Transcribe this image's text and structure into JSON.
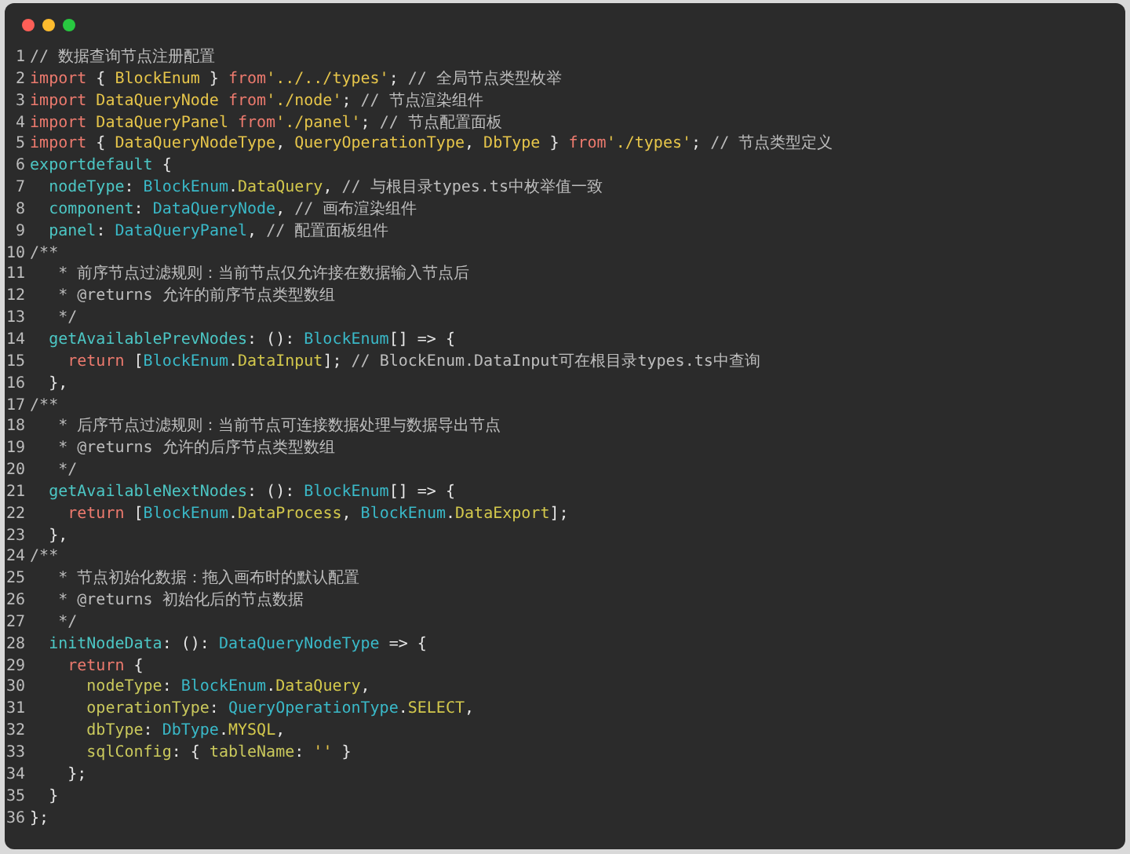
{
  "code_lines": [
    {
      "number": "1",
      "tokens": [
        {
          "text": "// 数据查询节点注册配置",
          "kind": "comment"
        }
      ]
    },
    {
      "number": "2",
      "tokens": [
        {
          "text": "import",
          "kind": "keyword"
        },
        {
          "text": " { ",
          "kind": "plain"
        },
        {
          "text": "BlockEnum",
          "kind": "ident"
        },
        {
          "text": " } ",
          "kind": "plain"
        },
        {
          "text": "from",
          "kind": "keyword"
        },
        {
          "text": "'../../types'",
          "kind": "string"
        },
        {
          "text": "; ",
          "kind": "plain"
        },
        {
          "text": "// 全局节点类型枚举",
          "kind": "comment"
        }
      ]
    },
    {
      "number": "3",
      "tokens": [
        {
          "text": "import",
          "kind": "keyword"
        },
        {
          "text": " DataQueryNode ",
          "kind": "ident"
        },
        {
          "text": "from",
          "kind": "keyword"
        },
        {
          "text": "'./node'",
          "kind": "string"
        },
        {
          "text": "; ",
          "kind": "plain"
        },
        {
          "text": "// 节点渲染组件",
          "kind": "comment"
        }
      ]
    },
    {
      "number": "4",
      "tokens": [
        {
          "text": "import",
          "kind": "keyword"
        },
        {
          "text": " DataQueryPanel ",
          "kind": "ident"
        },
        {
          "text": "from",
          "kind": "keyword"
        },
        {
          "text": "'./panel'",
          "kind": "string"
        },
        {
          "text": "; ",
          "kind": "plain"
        },
        {
          "text": "// 节点配置面板",
          "kind": "comment"
        }
      ]
    },
    {
      "number": "5",
      "tokens": [
        {
          "text": "import",
          "kind": "keyword"
        },
        {
          "text": " { ",
          "kind": "plain"
        },
        {
          "text": "DataQueryNodeType",
          "kind": "ident"
        },
        {
          "text": ", ",
          "kind": "plain"
        },
        {
          "text": "QueryOperationType",
          "kind": "ident"
        },
        {
          "text": ", ",
          "kind": "plain"
        },
        {
          "text": "DbType",
          "kind": "ident"
        },
        {
          "text": " } ",
          "kind": "plain"
        },
        {
          "text": "from",
          "kind": "keyword"
        },
        {
          "text": "'./types'",
          "kind": "string"
        },
        {
          "text": "; ",
          "kind": "plain"
        },
        {
          "text": "// 节点类型定义",
          "kind": "comment"
        }
      ]
    },
    {
      "number": "6",
      "tokens": [
        {
          "text": "exportdefault",
          "kind": "prop"
        },
        {
          "text": " {",
          "kind": "plain"
        }
      ]
    },
    {
      "number": "7",
      "tokens": [
        {
          "text": "  nodeType",
          "kind": "prop"
        },
        {
          "text": ": ",
          "kind": "plain"
        },
        {
          "text": "BlockEnum",
          "kind": "type"
        },
        {
          "text": ".",
          "kind": "plain"
        },
        {
          "text": "DataQuery",
          "kind": "member"
        },
        {
          "text": ", ",
          "kind": "plain"
        },
        {
          "text": "// 与根目录types.ts中枚举值一致",
          "kind": "comment"
        }
      ]
    },
    {
      "number": "8",
      "tokens": [
        {
          "text": "  component",
          "kind": "prop"
        },
        {
          "text": ": ",
          "kind": "plain"
        },
        {
          "text": "DataQueryNode",
          "kind": "type"
        },
        {
          "text": ", ",
          "kind": "plain"
        },
        {
          "text": "// 画布渲染组件",
          "kind": "comment"
        }
      ]
    },
    {
      "number": "9",
      "tokens": [
        {
          "text": "  panel",
          "kind": "prop"
        },
        {
          "text": ": ",
          "kind": "plain"
        },
        {
          "text": "DataQueryPanel",
          "kind": "type"
        },
        {
          "text": ", ",
          "kind": "plain"
        },
        {
          "text": "// 配置面板组件",
          "kind": "comment"
        }
      ]
    },
    {
      "number": "10",
      "tokens": [
        {
          "text": "/**",
          "kind": "comment"
        }
      ]
    },
    {
      "number": "11",
      "tokens": [
        {
          "text": "   * 前序节点过滤规则：当前节点仅允许接在数据输入节点后",
          "kind": "comment"
        }
      ]
    },
    {
      "number": "12",
      "tokens": [
        {
          "text": "   * @returns 允许的前序节点类型数组",
          "kind": "comment"
        }
      ]
    },
    {
      "number": "13",
      "tokens": [
        {
          "text": "   */",
          "kind": "comment"
        }
      ]
    },
    {
      "number": "14",
      "tokens": [
        {
          "text": "  getAvailablePrevNodes",
          "kind": "prop"
        },
        {
          "text": ": (): ",
          "kind": "plain"
        },
        {
          "text": "BlockEnum",
          "kind": "type"
        },
        {
          "text": "[] => {",
          "kind": "plain"
        }
      ]
    },
    {
      "number": "15",
      "tokens": [
        {
          "text": "    return",
          "kind": "keyword"
        },
        {
          "text": " [",
          "kind": "plain"
        },
        {
          "text": "BlockEnum",
          "kind": "type"
        },
        {
          "text": ".",
          "kind": "plain"
        },
        {
          "text": "DataInput",
          "kind": "member"
        },
        {
          "text": "]; ",
          "kind": "plain"
        },
        {
          "text": "// BlockEnum.DataInput可在根目录types.ts中查询",
          "kind": "comment"
        }
      ]
    },
    {
      "number": "16",
      "tokens": [
        {
          "text": "  },",
          "kind": "plain"
        }
      ]
    },
    {
      "number": "17",
      "tokens": [
        {
          "text": "/**",
          "kind": "comment"
        }
      ]
    },
    {
      "number": "18",
      "tokens": [
        {
          "text": "   * 后序节点过滤规则：当前节点可连接数据处理与数据导出节点",
          "kind": "comment"
        }
      ]
    },
    {
      "number": "19",
      "tokens": [
        {
          "text": "   * @returns 允许的后序节点类型数组",
          "kind": "comment"
        }
      ]
    },
    {
      "number": "20",
      "tokens": [
        {
          "text": "   */",
          "kind": "comment"
        }
      ]
    },
    {
      "number": "21",
      "tokens": [
        {
          "text": "  getAvailableNextNodes",
          "kind": "prop"
        },
        {
          "text": ": (): ",
          "kind": "plain"
        },
        {
          "text": "BlockEnum",
          "kind": "type"
        },
        {
          "text": "[] => {",
          "kind": "plain"
        }
      ]
    },
    {
      "number": "22",
      "tokens": [
        {
          "text": "    return",
          "kind": "keyword"
        },
        {
          "text": " [",
          "kind": "plain"
        },
        {
          "text": "BlockEnum",
          "kind": "type"
        },
        {
          "text": ".",
          "kind": "plain"
        },
        {
          "text": "DataProcess",
          "kind": "member"
        },
        {
          "text": ", ",
          "kind": "plain"
        },
        {
          "text": "BlockEnum",
          "kind": "type"
        },
        {
          "text": ".",
          "kind": "plain"
        },
        {
          "text": "DataExport",
          "kind": "member"
        },
        {
          "text": "];",
          "kind": "plain"
        }
      ]
    },
    {
      "number": "23",
      "tokens": [
        {
          "text": "  },",
          "kind": "plain"
        }
      ]
    },
    {
      "number": "24",
      "tokens": [
        {
          "text": "/**",
          "kind": "comment"
        }
      ]
    },
    {
      "number": "25",
      "tokens": [
        {
          "text": "   * 节点初始化数据：拖入画布时的默认配置",
          "kind": "comment"
        }
      ]
    },
    {
      "number": "26",
      "tokens": [
        {
          "text": "   * @returns 初始化后的节点数据",
          "kind": "comment"
        }
      ]
    },
    {
      "number": "27",
      "tokens": [
        {
          "text": "   */",
          "kind": "comment"
        }
      ]
    },
    {
      "number": "28",
      "tokens": [
        {
          "text": "  initNodeData",
          "kind": "prop"
        },
        {
          "text": ": (): ",
          "kind": "plain"
        },
        {
          "text": "DataQueryNodeType",
          "kind": "type"
        },
        {
          "text": " => {",
          "kind": "plain"
        }
      ]
    },
    {
      "number": "29",
      "tokens": [
        {
          "text": "    return",
          "kind": "keyword"
        },
        {
          "text": " {",
          "kind": "plain"
        }
      ]
    },
    {
      "number": "30",
      "tokens": [
        {
          "text": "      nodeType",
          "kind": "field"
        },
        {
          "text": ": ",
          "kind": "plain"
        },
        {
          "text": "BlockEnum",
          "kind": "type"
        },
        {
          "text": ".",
          "kind": "plain"
        },
        {
          "text": "DataQuery",
          "kind": "member"
        },
        {
          "text": ",",
          "kind": "plain"
        }
      ]
    },
    {
      "number": "31",
      "tokens": [
        {
          "text": "      operationType",
          "kind": "field"
        },
        {
          "text": ": ",
          "kind": "plain"
        },
        {
          "text": "QueryOperationType",
          "kind": "type"
        },
        {
          "text": ".",
          "kind": "plain"
        },
        {
          "text": "SELECT",
          "kind": "member"
        },
        {
          "text": ",",
          "kind": "plain"
        }
      ]
    },
    {
      "number": "32",
      "tokens": [
        {
          "text": "      dbType",
          "kind": "field"
        },
        {
          "text": ": ",
          "kind": "plain"
        },
        {
          "text": "DbType",
          "kind": "type"
        },
        {
          "text": ".",
          "kind": "plain"
        },
        {
          "text": "MYSQL",
          "kind": "member"
        },
        {
          "text": ",",
          "kind": "plain"
        }
      ]
    },
    {
      "number": "33",
      "tokens": [
        {
          "text": "      sqlConfig",
          "kind": "field"
        },
        {
          "text": ": { ",
          "kind": "plain"
        },
        {
          "text": "tableName",
          "kind": "field"
        },
        {
          "text": ": ",
          "kind": "plain"
        },
        {
          "text": "''",
          "kind": "string"
        },
        {
          "text": " }",
          "kind": "plain"
        }
      ]
    },
    {
      "number": "34",
      "tokens": [
        {
          "text": "    };",
          "kind": "plain"
        }
      ]
    },
    {
      "number": "35",
      "tokens": [
        {
          "text": "  }",
          "kind": "plain"
        }
      ]
    },
    {
      "number": "36",
      "tokens": [
        {
          "text": "};",
          "kind": "plain"
        }
      ]
    }
  ]
}
